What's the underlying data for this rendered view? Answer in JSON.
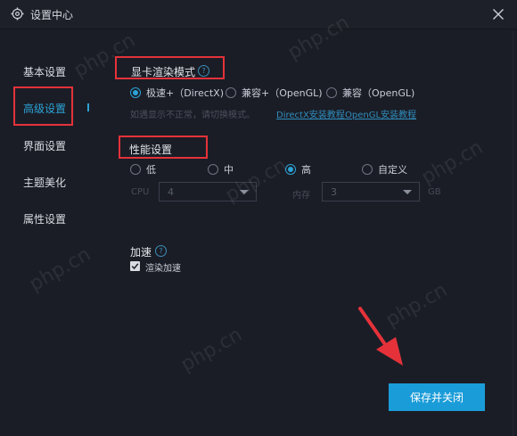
{
  "window": {
    "title": "设置中心",
    "icon": "gear-icon",
    "close_icon": "close-icon"
  },
  "sidebar": {
    "items": [
      {
        "label": "基本设置"
      },
      {
        "label": "高级设置",
        "active": true
      },
      {
        "label": "界面设置"
      },
      {
        "label": "主题美化"
      },
      {
        "label": "属性设置"
      }
    ]
  },
  "gpu": {
    "title": "显卡渲染模式",
    "options": [
      {
        "label": "极速+（DirectX)",
        "selected": true
      },
      {
        "label": "兼容+（OpenGL)",
        "selected": false
      },
      {
        "label": "兼容（OpenGL)",
        "selected": false
      }
    ],
    "hint": "如遇显示不正常，请切换模式。",
    "links": [
      "DirectX安装教程",
      "OpenGL安装教程"
    ]
  },
  "performance": {
    "title": "性能设置",
    "options": [
      {
        "label": "低",
        "selected": false
      },
      {
        "label": "中",
        "selected": false
      },
      {
        "label": "高",
        "selected": true
      },
      {
        "label": "自定义",
        "selected": false
      }
    ],
    "cpu_label": "CPU",
    "cpu_value": "4",
    "mem_label": "内存",
    "mem_value": "3",
    "mem_unit": "GB"
  },
  "accel": {
    "title": "加速",
    "checkbox_label": "渲染加速",
    "checked": true
  },
  "footer": {
    "save_label": "保存并关闭"
  },
  "watermark": "php.cn",
  "colors": {
    "accent": "#1a9cd8",
    "highlight_box": "#e5323a",
    "background": "#1b1d26"
  }
}
